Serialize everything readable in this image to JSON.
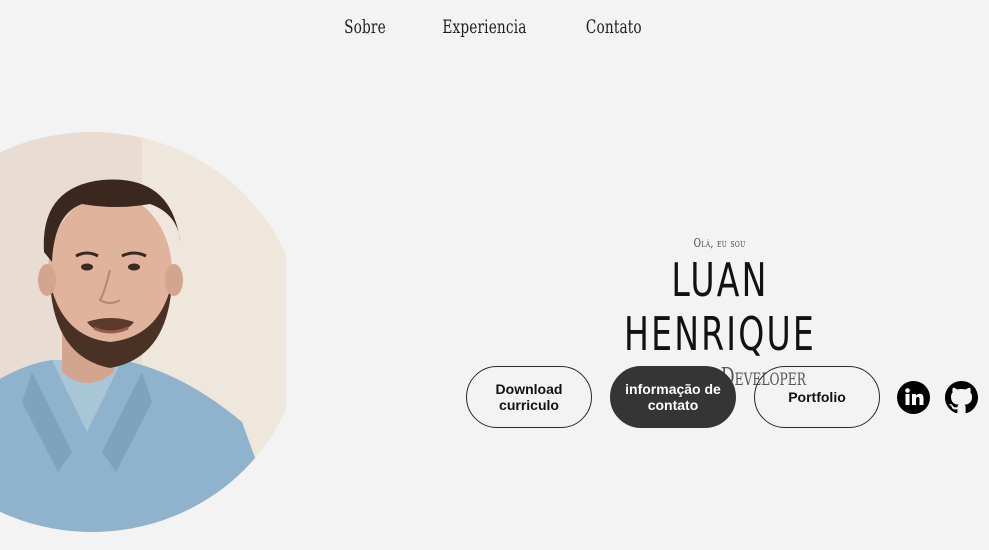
{
  "nav": {
    "items": [
      {
        "label": "Sobre"
      },
      {
        "label": "Experiencia"
      },
      {
        "label": "Contato"
      }
    ]
  },
  "hero": {
    "greeting": "Olá, eu sou",
    "name": "LUAN HENRIQUE",
    "role": "Fullstack Developer"
  },
  "buttons": {
    "download": "Download curriculo",
    "contact": "informação de contato",
    "portfolio": "Portfolio"
  },
  "social": {
    "linkedin_icon": "linkedin-icon",
    "github_icon": "github-icon"
  },
  "colors": {
    "background": "#f3f3f3",
    "text": "#111111",
    "dark_button": "#353535"
  }
}
